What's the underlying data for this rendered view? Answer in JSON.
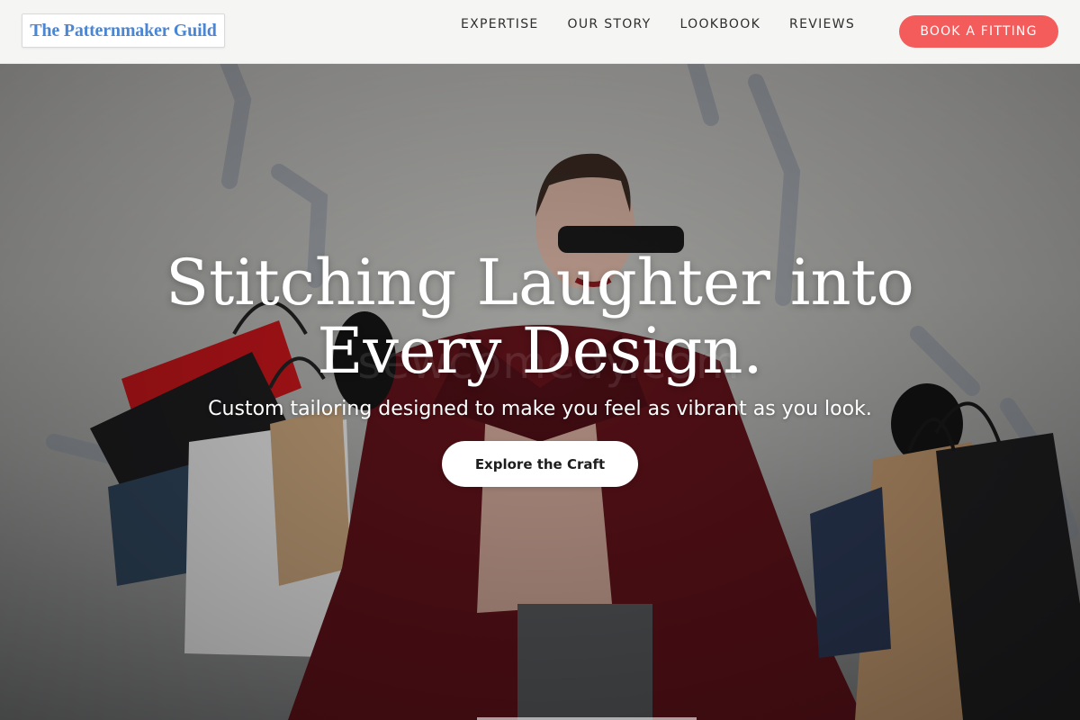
{
  "header": {
    "logo_text": "The Patternmaker Guild",
    "nav": [
      {
        "label": "EXPERTISE"
      },
      {
        "label": "OUR STORY"
      },
      {
        "label": "LOOKBOOK"
      },
      {
        "label": "REVIEWS"
      }
    ],
    "cta_label": "BOOK A FITTING"
  },
  "hero": {
    "title_line1": "Stitching Laughter into",
    "title_line2": "Every Design.",
    "subtitle": "Custom tailoring designed to make you feel as vibrant as you look.",
    "button_label": "Explore the Craft",
    "watermark_text": "sewcomedy.com"
  },
  "colors": {
    "logo_text": "#4a86d4",
    "cta_background": "#f45b5b",
    "header_background": "#f5f5f4",
    "hero_button_background": "#ffffff"
  }
}
